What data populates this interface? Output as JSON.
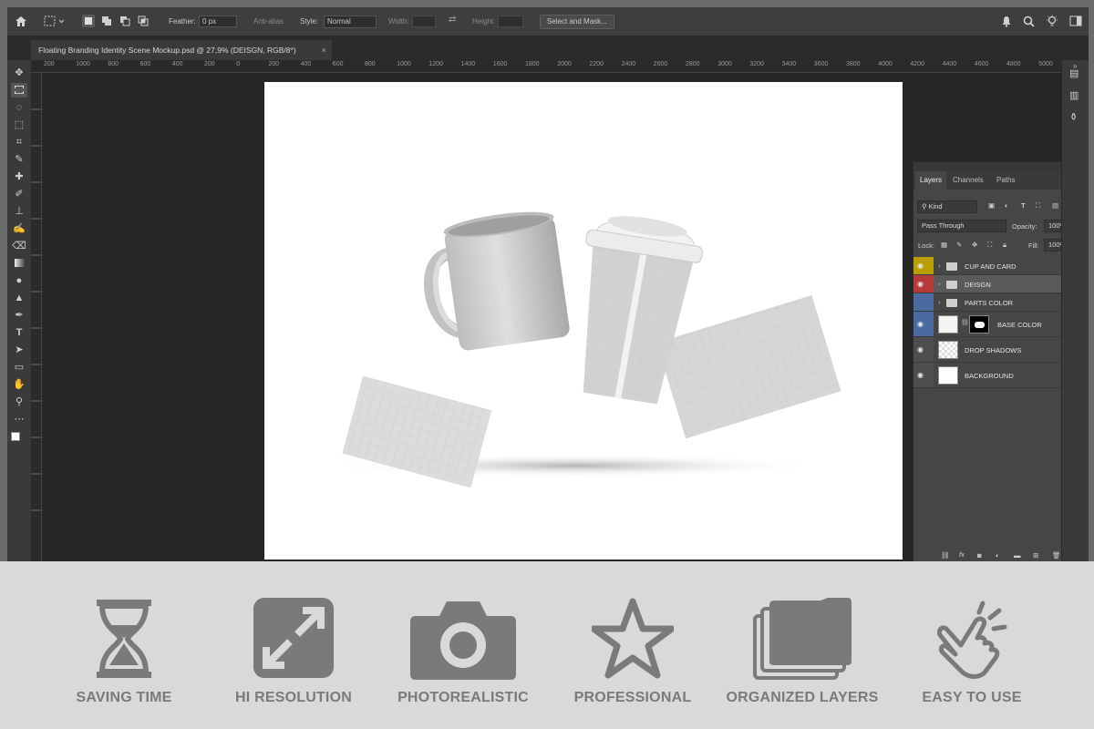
{
  "options_bar": {
    "feather_label": "Feather:",
    "feather_value": "0 px",
    "anti_alias_label": "Anti-alias",
    "style_label": "Style:",
    "style_value": "Normal",
    "width_label": "Width:",
    "height_label": "Height:",
    "select_mask_label": "Select and Mask..."
  },
  "document_tab": {
    "title": "Floating Branding Identity Scene Mockup.psd @ 27,9% (DEISGN, RGB/8*)",
    "close_glyph": "×"
  },
  "ruler": {
    "h_ticks": [
      "200",
      "1000",
      "800",
      "600",
      "400",
      "200",
      "0",
      "200",
      "400",
      "600",
      "800",
      "1000",
      "1200",
      "1400",
      "1600",
      "1800",
      "2000",
      "2200",
      "2400",
      "2600",
      "2800",
      "3000",
      "3200",
      "3400",
      "3600",
      "3800",
      "4000",
      "4200",
      "4400",
      "4600",
      "4800",
      "5000"
    ]
  },
  "layers_panel": {
    "tabs": [
      "Layers",
      "Channels",
      "Paths"
    ],
    "kind_label": "Kind",
    "blend_mode": "Pass Through",
    "opacity_label": "Opacity:",
    "opacity_value": "100%",
    "lock_label": "Lock:",
    "fill_label": "Fill:",
    "fill_value": "100%",
    "layers": [
      {
        "name": "CUP AND CARD",
        "type": "group",
        "color": "#b8a000",
        "visible": true
      },
      {
        "name": "DEISGN",
        "type": "group",
        "color": "#b53a3a",
        "visible": true,
        "selected": true
      },
      {
        "name": "PARTS COLOR",
        "type": "group",
        "color": "#4a6aa0",
        "visible": false
      },
      {
        "name": "BASE COLOR",
        "type": "layer-mask",
        "color": "#4a6aa0",
        "visible": true
      },
      {
        "name": "DROP SHADOWS",
        "type": "layer",
        "color": null,
        "visible": true
      },
      {
        "name": "BACKGROUND",
        "type": "layer",
        "color": null,
        "visible": true
      }
    ]
  },
  "features": [
    {
      "label": "SAVING TIME",
      "icon": "hourglass-icon"
    },
    {
      "label": "HI RESOLUTION",
      "icon": "expand-arrows-icon"
    },
    {
      "label": "PHOTOREALISTIC",
      "icon": "camera-icon"
    },
    {
      "label": "PROFESSIONAL",
      "icon": "star-icon"
    },
    {
      "label": "ORGANIZED LAYERS",
      "icon": "layers-folder-icon"
    },
    {
      "label": "EASY TO USE",
      "icon": "pointer-hand-icon"
    }
  ],
  "colors": {
    "ps_bg": "#323232",
    "canvas_bg": "#262626",
    "feature_text": "#7a7a7a",
    "feature_icon": "#7a7a7a"
  }
}
